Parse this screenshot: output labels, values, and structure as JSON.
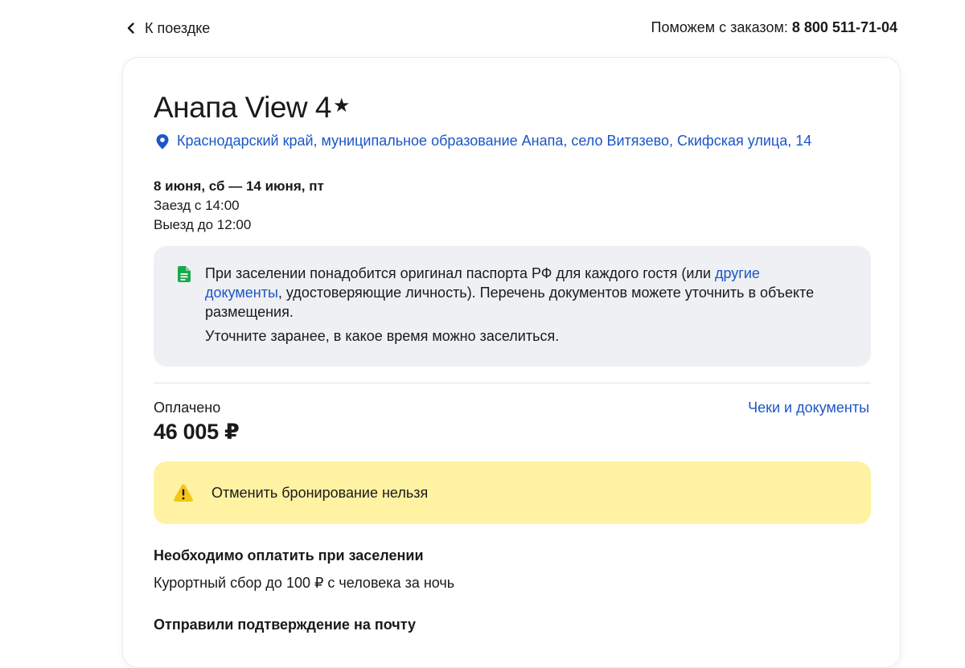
{
  "header": {
    "back_label": "К поездке",
    "help_text": "Поможем с заказом:",
    "phone": "8 800 511-71-04"
  },
  "hotel": {
    "name": "Анапа View 4",
    "star_glyph": "★",
    "address": "Краснодарский край, муниципальное образование Анапа, село Витязево, Скифская улица, 14"
  },
  "stay": {
    "dates": "8 июня, сб — 14 июня, пт",
    "check_in": "Заезд с 14:00",
    "check_out": "Выезд до 12:00"
  },
  "documents_notice": {
    "text_before_link": "При заселении понадобится оригинал паспорта РФ для каждого гостя (или ",
    "link_text": "другие документы",
    "text_after_link": ", удостоверяющие личность). Перечень документов можете уточнить в объекте размещения.",
    "second_line": "Уточните заранее, в какое время можно заселиться."
  },
  "payment": {
    "paid_label": "Оплачено",
    "amount": "46 005 ₽",
    "receipts_link": "Чеки и документы"
  },
  "cancellation": {
    "warning": "Отменить бронирование нельзя"
  },
  "pay_on_arrival": {
    "title": "Необходимо оплатить при заселении",
    "text": "Курортный сбор до 100 ₽ с человека за ночь"
  },
  "confirmation": {
    "title": "Отправили подтверждение на почту"
  },
  "colors": {
    "link": "#1c56c7",
    "info_bg": "#eef0f3",
    "warning_bg": "#fff2a3",
    "doc_icon": "#19a94a"
  }
}
